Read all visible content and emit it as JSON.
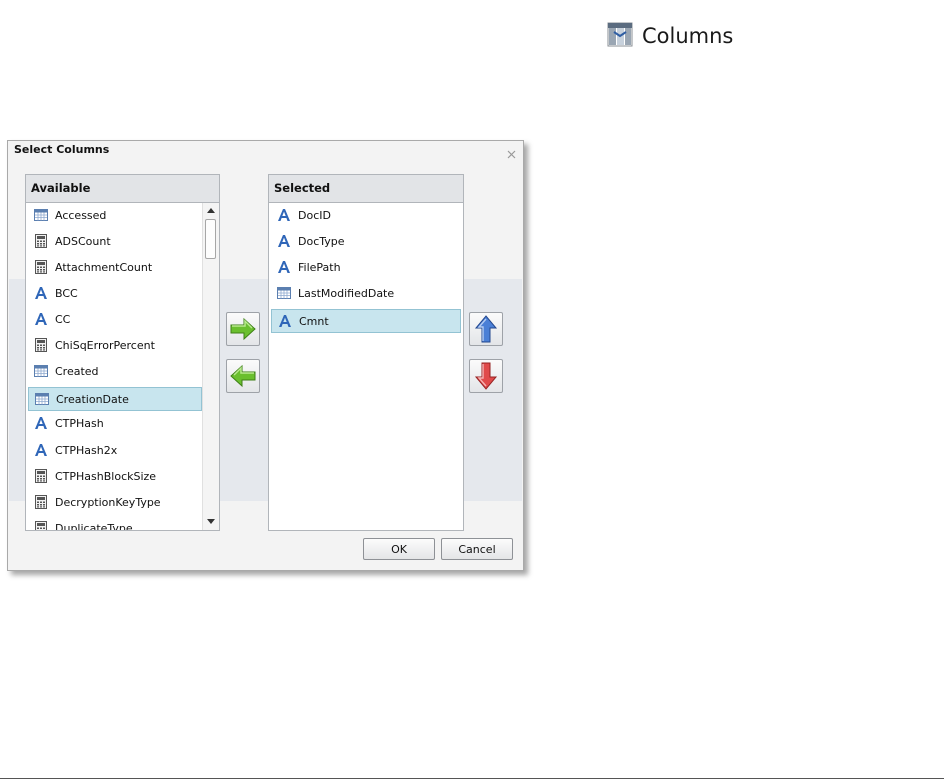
{
  "toolbar": {
    "columns_label": "Columns",
    "icon": "columns-icon"
  },
  "dialog": {
    "title": "Select Columns",
    "available": {
      "header": "Available",
      "items": [
        {
          "label": "Accessed",
          "type": "date"
        },
        {
          "label": "ADSCount",
          "type": "number"
        },
        {
          "label": "AttachmentCount",
          "type": "number"
        },
        {
          "label": "BCC",
          "type": "text"
        },
        {
          "label": "CC",
          "type": "text"
        },
        {
          "label": "ChiSqErrorPercent",
          "type": "number"
        },
        {
          "label": "Created",
          "type": "date"
        },
        {
          "label": "CreationDate",
          "type": "date"
        },
        {
          "label": "CTPHash",
          "type": "text"
        },
        {
          "label": "CTPHash2x",
          "type": "text"
        },
        {
          "label": "CTPHashBlockSize",
          "type": "number"
        },
        {
          "label": "DecryptionKeyType",
          "type": "number"
        },
        {
          "label": "DuplicateType",
          "type": "number"
        }
      ],
      "selected_index": 7
    },
    "selected": {
      "header": "Selected",
      "items": [
        {
          "label": "DocID",
          "type": "text"
        },
        {
          "label": "DocType",
          "type": "text"
        },
        {
          "label": "FilePath",
          "type": "text"
        },
        {
          "label": "LastModifiedDate",
          "type": "date"
        },
        {
          "label": "Cmnt",
          "type": "text"
        }
      ],
      "selected_index": 4
    },
    "buttons": {
      "ok": "OK",
      "cancel": "Cancel"
    },
    "colors": {
      "selection": "#c8e5ee",
      "arrow_green": "#6abf2e",
      "arrow_up": "#4a7fd6",
      "arrow_down": "#e04a4a"
    }
  }
}
